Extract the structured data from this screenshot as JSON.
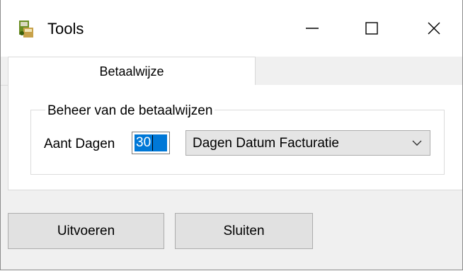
{
  "window": {
    "title": "Tools",
    "app_icon": "tools-app-icon",
    "controls": {
      "minimize_icon": "minimize-icon",
      "maximize_icon": "maximize-icon",
      "close_icon": "close-icon"
    }
  },
  "tabs": [
    {
      "label": "Betaalwijze",
      "selected": true
    }
  ],
  "group": {
    "legend": "Beheer van de betaalwijzen",
    "days_label": "Aant Dagen",
    "days_value": "30",
    "combo_value": "Dagen Datum Facturatie",
    "combo_arrow_icon": "chevron-down-icon"
  },
  "buttons": {
    "run_label": "Uitvoeren",
    "close_label": "Sluiten"
  },
  "colors": {
    "selection": "#0078d7",
    "button_face": "#e1e1e1",
    "window_bg": "#f0f0f0"
  }
}
